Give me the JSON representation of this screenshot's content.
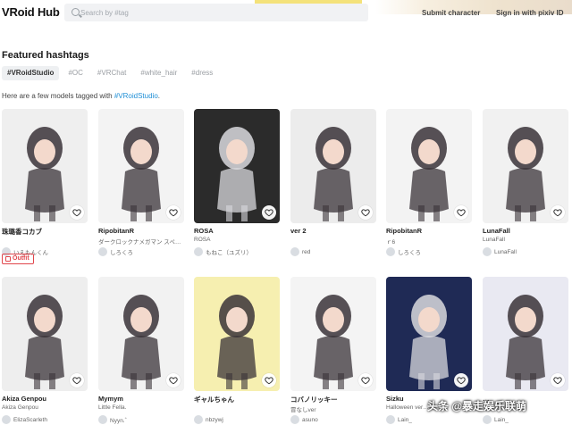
{
  "header": {
    "logo": "VRoid Hub",
    "search_placeholder": "Search by #tag",
    "submit": "Submit character",
    "signin": "Sign in with pixiv ID"
  },
  "featured": {
    "title": "Featured hashtags",
    "tags": [
      "#VRoidStudio",
      "#OC",
      "#VRChat",
      "#white_hair",
      "#dress"
    ],
    "active_tag": "#VRoidStudio",
    "intro_prefix": "Here are a few models tagged with ",
    "intro_tag": "#VRoidStudio",
    "intro_suffix": "."
  },
  "cards": [
    {
      "title": "珠璐香コカブ",
      "sub": "",
      "author": "いえもんくん",
      "bg": "#efefef",
      "badge": "Outfit"
    },
    {
      "title": "RipobitanR",
      "sub": "ダークロックナメガマン  スペ…",
      "author": "しろくろ",
      "bg": "#f3f3f3"
    },
    {
      "title": "ROSA",
      "sub": "ROSA",
      "author": "もねこ（ユズリ）",
      "bg": "#2b2b2b"
    },
    {
      "title": "ver 2",
      "sub": "",
      "author": "red",
      "bg": "#ececec"
    },
    {
      "title": "RipobitanR",
      "sub": "ｒ6",
      "author": "しろくろ",
      "bg": "#f3f3f3"
    },
    {
      "title": "LunaFall",
      "sub": "LunaFall",
      "author": "LunaFall",
      "bg": "#f1f1f1"
    },
    {
      "title": "Akiza Genpou",
      "sub": "Akiza Genpou",
      "author": "ElizaScarleth",
      "bg": "#eeeeee"
    },
    {
      "title": "Mymym",
      "sub": "Little Fella.",
      "author": "Nyyn.゛",
      "bg": "#f2f2f2"
    },
    {
      "title": "ギャルちゃん",
      "sub": "",
      "author": "nbzywj",
      "bg": "#f6efb0"
    },
    {
      "title": "コバノリッキー",
      "sub": "冒なしver",
      "author": "asuno",
      "bg": "#f4f4f4"
    },
    {
      "title": "Sizku",
      "sub": "Halloween ver…",
      "author": "Lain_",
      "bg": "#1f2a55"
    },
    {
      "title": "…",
      "sub": "",
      "author": "Lain_",
      "bg": "#e9e9f2"
    }
  ],
  "watermark": "头条 @暴走娱乐联萌"
}
